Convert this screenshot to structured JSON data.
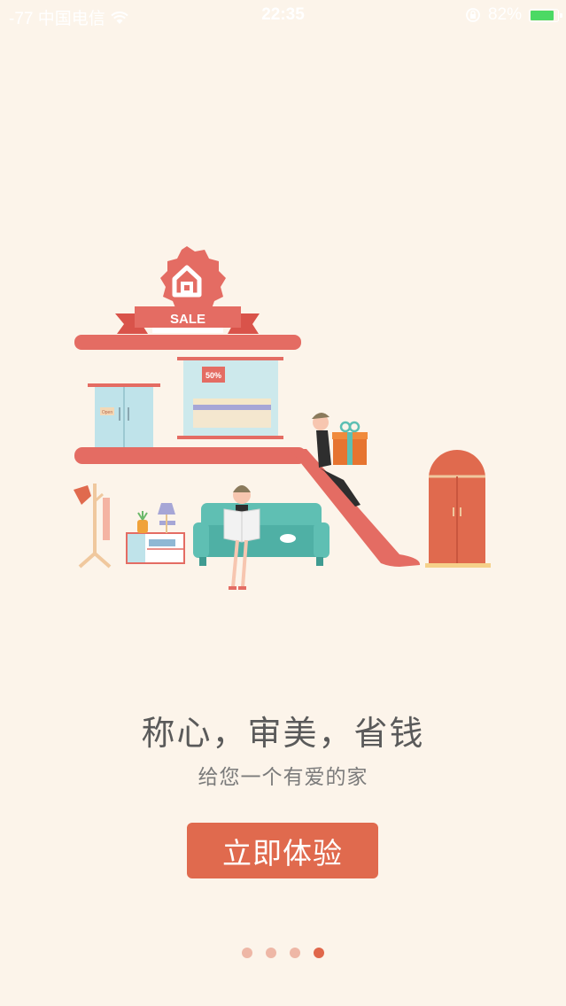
{
  "status_bar": {
    "carrier": "-77 中国电信",
    "time": "22:35",
    "battery": "82%",
    "battery_level": 0.82
  },
  "illustration": {
    "sale_banner": "SALE",
    "discount_tag": "50%",
    "door_sign": "Open"
  },
  "onboarding": {
    "headline": "称心，审美，省钱",
    "subline": "给您一个有爱的家",
    "cta_label": "立即体验",
    "page_count": 4,
    "current_page": 4
  },
  "colors": {
    "background": "#fcf4ea",
    "accent": "#e06a4e",
    "dot_inactive": "#eeb7a6",
    "dot_active": "#e0674b"
  }
}
